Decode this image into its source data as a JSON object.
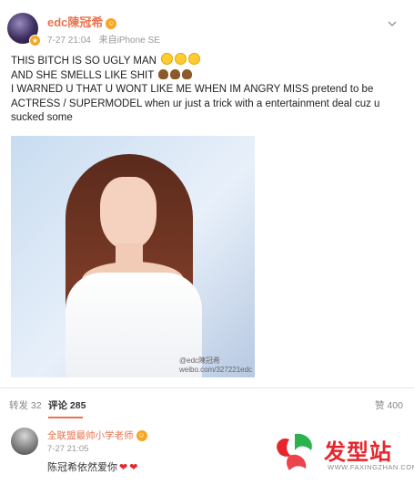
{
  "post": {
    "username": "edc陳冠希",
    "time": "7-27 21:04",
    "source": "来自iPhone SE",
    "lines": [
      "THIS BITCH IS SO UGLY MAN",
      "AND SHE SMELLS LIKE SHIT",
      "I WARNED U THAT U WONT LIKE ME WHEN IM ANGRY MISS pretend to be ACTRESS / SUPERMODEL when ur just a trick with a entertainment deal cuz u sucked some"
    ],
    "photo_watermark_line1": "weibo.com/32",
    "photo_watermark_line2": "7221edc",
    "photo_watermark_top": "@edc陳冠希"
  },
  "actions": {
    "repost_label": "转发",
    "repost_count": "32",
    "comment_label": "评论",
    "comment_count": "285",
    "like_label": "赞",
    "like_count": "400"
  },
  "comment": {
    "username": "全联盟最帅小学老师",
    "time": "7-27 21:05",
    "text": "陈冠希依然爱你"
  },
  "logo": {
    "text": "发型站",
    "url": "WWW.FAXINGZHAN.COM"
  },
  "colors": {
    "accent": "#eb7350",
    "heart": "#e8242c",
    "badge": "#f5a623"
  }
}
